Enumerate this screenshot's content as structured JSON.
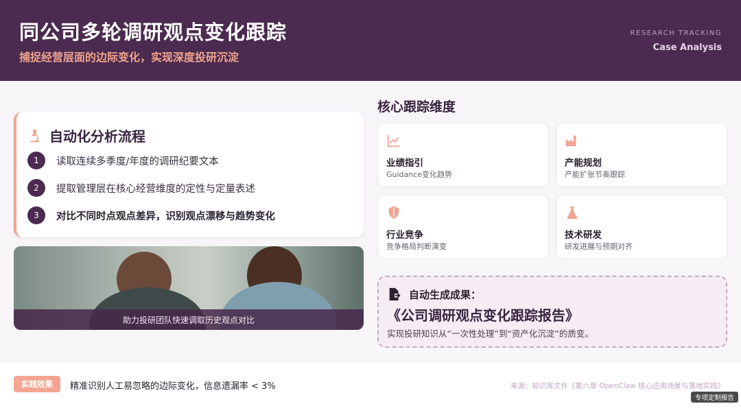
{
  "header": {
    "title": "同公司多轮调研观点变化跟踪",
    "subtitle": "捕捉经营层面的边际变化，实现深度投研沉淀",
    "tag_small": "RESEARCH TRACKING",
    "tag_large": "Case Analysis"
  },
  "flow": {
    "icon": "microscope-icon",
    "title": "自动化分析流程",
    "steps": [
      {
        "num": "1",
        "text": "读取连续多季度/年度的调研纪要文本"
      },
      {
        "num": "2",
        "text": "提取管理层在核心经营维度的定性与定量表述"
      },
      {
        "num": "3",
        "text": "对比不同时点观点差异，识别观点漂移与趋势变化"
      }
    ]
  },
  "photo": {
    "caption": "助力投研团队快速调取历史观点对比"
  },
  "dimensions": {
    "title": "核心跟踪维度",
    "items": [
      {
        "icon": "chart-line-icon",
        "name": "业绩指引",
        "desc": "Guidance变化趋势"
      },
      {
        "icon": "factory-icon",
        "name": "产能规划",
        "desc": "产能扩张节奏跟踪"
      },
      {
        "icon": "shield-icon",
        "name": "行业竞争",
        "desc": "竞争格局判断演变"
      },
      {
        "icon": "flask-icon",
        "name": "技术研发",
        "desc": "研发进展与预期对齐"
      }
    ]
  },
  "result": {
    "icon": "file-export-icon",
    "label": "自动生成成果：",
    "title": "《公司调研观点变化跟踪报告》",
    "desc": "实现投研知识从“一次性处理”到“资产化沉淀”的质变。"
  },
  "footer": {
    "badge": "实践效果",
    "text": "精准识别人工易忽略的边际变化，信息遗漏率 < 3%",
    "source": "来源：知识库文件《第六章 OpenClaw 核心应用场景与落地实践》",
    "report_button": "专项定制报告"
  },
  "colors": {
    "header_bg": "#4b2b4f",
    "accent": "#f1a48f",
    "step_circle": "#4b2b4f"
  }
}
